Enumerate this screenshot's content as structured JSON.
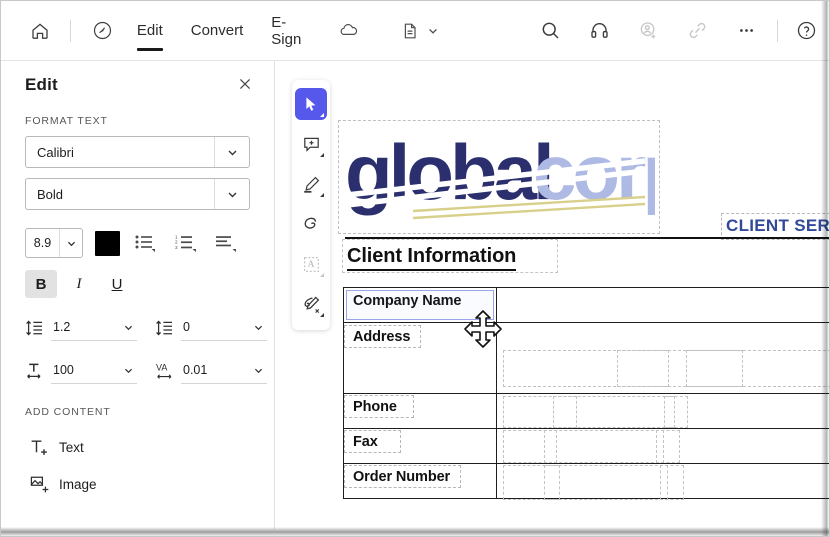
{
  "toolbar": {
    "home_icon": "home-icon",
    "clock_icon": "recent-icon",
    "tabs": [
      {
        "label": "Edit",
        "active": true
      },
      {
        "label": "Convert",
        "active": false
      },
      {
        "label": "E-Sign",
        "active": false
      }
    ],
    "right_icons": [
      {
        "name": "cloud-icon",
        "dim": false
      },
      {
        "name": "document-icon",
        "dim": false
      },
      {
        "name": "chevron-down-icon",
        "dim": false
      },
      {
        "name": "search-icon",
        "dim": false
      },
      {
        "name": "headphones-icon",
        "dim": false
      },
      {
        "name": "add-person-icon",
        "dim": true
      },
      {
        "name": "link-icon",
        "dim": true
      },
      {
        "name": "more-icon",
        "dim": false
      },
      {
        "name": "help-icon",
        "dim": false
      }
    ]
  },
  "panel": {
    "title": "Edit",
    "close_icon": "close-icon",
    "format_section_label": "FORMAT TEXT",
    "font_family": "Calibri",
    "font_style": "Bold",
    "font_size": "8.9",
    "text_color": "#000000",
    "list_icons": [
      "bullet-list-icon",
      "numbered-list-icon",
      "align-icon"
    ],
    "bold_label": "B",
    "italic_label": "I",
    "underline_label": "U",
    "bold_active": true,
    "spacing": [
      {
        "icon": "line-spacing-icon",
        "value": "1.2"
      },
      {
        "icon": "paragraph-spacing-icon",
        "value": "0"
      },
      {
        "icon": "horizontal-scale-icon",
        "value": "100"
      },
      {
        "icon": "character-spacing-icon",
        "value": "0.01"
      }
    ],
    "add_content_label": "ADD CONTENT",
    "add_content_items": [
      {
        "icon": "add-text-icon",
        "label": "Text"
      },
      {
        "icon": "add-image-icon",
        "label": "Image"
      }
    ]
  },
  "tools": [
    {
      "name": "select-tool",
      "active": true
    },
    {
      "name": "comment-tool",
      "active": false
    },
    {
      "name": "highlight-tool",
      "active": false
    },
    {
      "name": "draw-tool",
      "active": false
    },
    {
      "name": "text-select-tool",
      "active": false,
      "dim": true
    },
    {
      "name": "sign-tool",
      "active": false
    }
  ],
  "document": {
    "logo": {
      "text_dark": "global",
      "text_light": "corp",
      "color_dark": "#2b2f6e",
      "color_light": "#aebae4",
      "accent_line_color": "#d8d08a"
    },
    "header_right": "CLIENT SERVICE",
    "header_right_color": "#32499b",
    "section_heading": "Client Information",
    "table_rows": [
      {
        "label": "Company Name",
        "value": "",
        "selected": true
      },
      {
        "label": "Address",
        "value": "",
        "selected": false
      },
      {
        "label": "Phone",
        "value": "",
        "selected": false
      },
      {
        "label": "Fax",
        "value": "",
        "selected": false
      },
      {
        "label": "Order Number",
        "value": "",
        "selected": false
      }
    ]
  },
  "cursor": {
    "name": "move-cursor"
  }
}
